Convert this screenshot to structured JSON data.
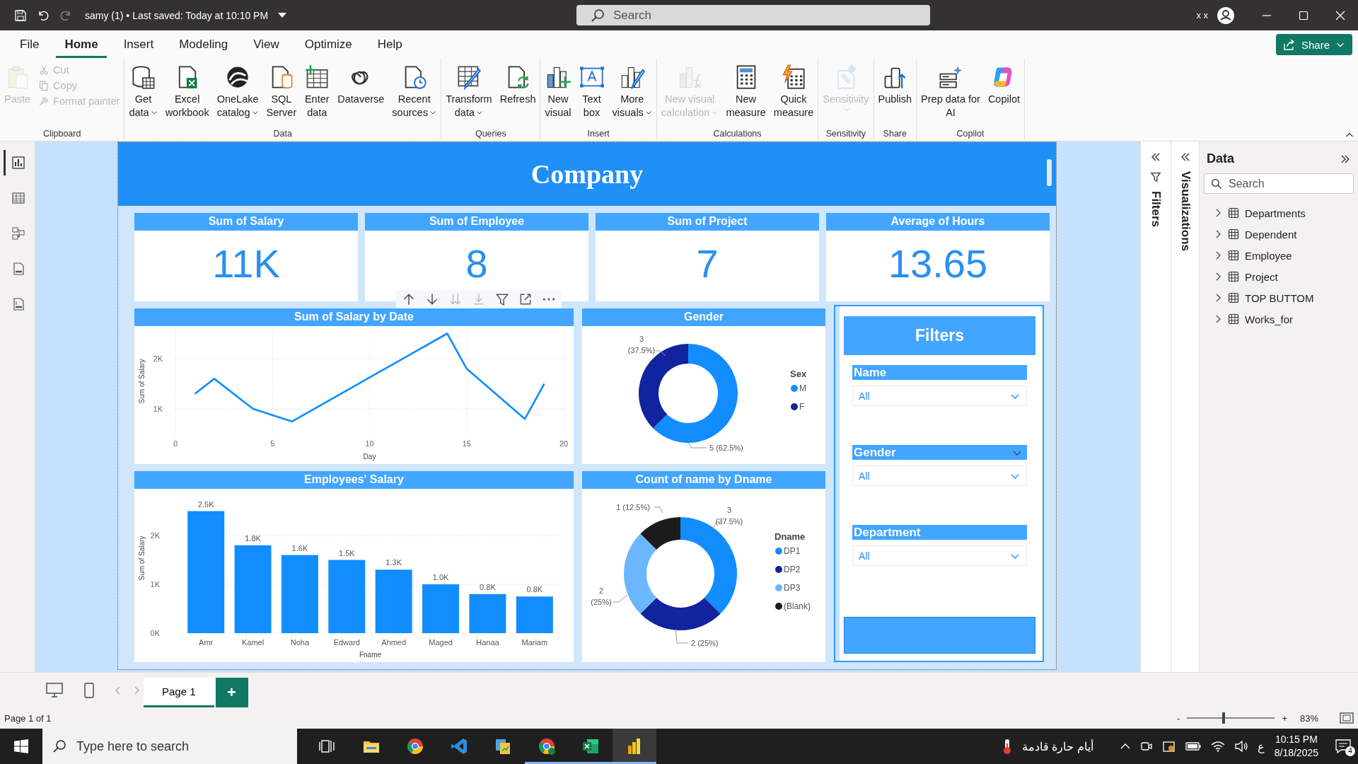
{
  "title_bar": {
    "document": "samy (1) • Last saved: Today at 10:10 PM",
    "search": {
      "placeholder": "Search"
    },
    "user": "x x"
  },
  "menu_tabs": [
    {
      "label": "File",
      "selected": false
    },
    {
      "label": "Home",
      "selected": true
    },
    {
      "label": "Insert",
      "selected": false
    },
    {
      "label": "Modeling",
      "selected": false
    },
    {
      "label": "View",
      "selected": false
    },
    {
      "label": "Optimize",
      "selected": false
    },
    {
      "label": "Help",
      "selected": false
    }
  ],
  "share_button": "Share",
  "ribbon": {
    "groups": [
      {
        "name": "Clipboard",
        "items": [
          {
            "kind": "large",
            "lines": [
              "Paste"
            ],
            "disabled": true,
            "dropdown": false
          },
          {
            "kind": "small",
            "lines": [
              "Cut"
            ],
            "disabled": true,
            "dropdown": false
          },
          {
            "kind": "small",
            "lines": [
              "Copy"
            ],
            "disabled": true,
            "dropdown": false
          },
          {
            "kind": "small",
            "lines": [
              "Format painter"
            ],
            "disabled": true,
            "dropdown": false
          }
        ]
      },
      {
        "name": "Data",
        "items": [
          {
            "kind": "large",
            "lines": [
              "Get",
              "data"
            ],
            "disabled": false,
            "dropdown": true
          },
          {
            "kind": "large",
            "lines": [
              "Excel",
              "workbook"
            ],
            "disabled": false,
            "dropdown": false
          },
          {
            "kind": "large",
            "lines": [
              "OneLake",
              "catalog"
            ],
            "disabled": false,
            "dropdown": true
          },
          {
            "kind": "large",
            "lines": [
              "SQL",
              "Server"
            ],
            "disabled": false,
            "dropdown": false
          },
          {
            "kind": "large",
            "lines": [
              "Enter",
              "data"
            ],
            "disabled": false,
            "dropdown": false
          },
          {
            "kind": "large",
            "lines": [
              "Dataverse"
            ],
            "disabled": false,
            "dropdown": false
          },
          {
            "kind": "large",
            "lines": [
              "Recent",
              "sources"
            ],
            "disabled": false,
            "dropdown": true
          }
        ]
      },
      {
        "name": "Queries",
        "items": [
          {
            "kind": "large",
            "lines": [
              "Transform",
              "data"
            ],
            "disabled": false,
            "dropdown": true
          },
          {
            "kind": "large",
            "lines": [
              "Refresh"
            ],
            "disabled": false,
            "dropdown": false
          }
        ]
      },
      {
        "name": "Insert",
        "items": [
          {
            "kind": "large",
            "lines": [
              "New",
              "visual"
            ],
            "disabled": false,
            "dropdown": false
          },
          {
            "kind": "large",
            "lines": [
              "Text",
              "box"
            ],
            "disabled": false,
            "dropdown": false
          },
          {
            "kind": "large",
            "lines": [
              "More",
              "visuals"
            ],
            "disabled": false,
            "dropdown": true
          }
        ]
      },
      {
        "name": "Calculations",
        "items": [
          {
            "kind": "large",
            "lines": [
              "New visual",
              "calculation"
            ],
            "disabled": true,
            "dropdown": true
          },
          {
            "kind": "large",
            "lines": [
              "New",
              "measure"
            ],
            "disabled": false,
            "dropdown": false
          },
          {
            "kind": "large",
            "lines": [
              "Quick",
              "measure"
            ],
            "disabled": false,
            "dropdown": false
          }
        ]
      },
      {
        "name": "Sensitivity",
        "items": [
          {
            "kind": "large",
            "lines": [
              "Sensitivity"
            ],
            "disabled": true,
            "dropdown": true
          }
        ]
      },
      {
        "name": "Share",
        "items": [
          {
            "kind": "large",
            "lines": [
              "Publish"
            ],
            "disabled": false,
            "dropdown": false
          }
        ]
      },
      {
        "name": "Copilot",
        "items": [
          {
            "kind": "large",
            "lines": [
              "Prep data for",
              "AI"
            ],
            "disabled": false,
            "dropdown": false
          },
          {
            "kind": "large",
            "lines": [
              "Copilot"
            ],
            "disabled": false,
            "dropdown": false
          }
        ]
      }
    ]
  },
  "view_switcher": [
    {
      "selected": true
    },
    {
      "selected": false
    },
    {
      "selected": false
    },
    {
      "selected": false
    },
    {
      "selected": false
    }
  ],
  "report": {
    "title": "Company",
    "cards": [
      {
        "label": "Sum of Salary",
        "value": "11K"
      },
      {
        "label": "Sum of Employee",
        "value": "8"
      },
      {
        "label": "Sum of Project",
        "value": "7"
      },
      {
        "label": "Average of Hours",
        "value": "13.65"
      }
    ],
    "charts": [
      {
        "chart_data": {
          "type": "line",
          "title": "Sum of Salary by Date",
          "grid": true,
          "xlabel": "Day",
          "ylabel": "Sum of Salary",
          "x": [
            1,
            2,
            4,
            6,
            14,
            15,
            18,
            19
          ],
          "values": [
            1300,
            1600,
            1000,
            750,
            2500,
            1800,
            800,
            1500
          ],
          "xlim": [
            0,
            20
          ],
          "ylim": [
            500,
            2600
          ],
          "xticks": [
            0,
            5,
            10,
            15,
            20
          ],
          "yticks": [
            {
              "value": 1000,
              "label": "1K"
            },
            {
              "value": 2000,
              "label": "2K"
            }
          ]
        }
      },
      {
        "chart_data": {
          "type": "donut",
          "title": "Gender",
          "categories": [
            "M",
            "F"
          ],
          "values": [
            5,
            3
          ],
          "colors": [
            "#118dff",
            "#12239e"
          ],
          "value_labels": [
            "5 (62.5%)",
            "3 (37.5%)"
          ],
          "legend": true
        },
        "legend_title": "Sex"
      },
      {
        "chart_data": {
          "type": "bar",
          "title": "Employees' Salary",
          "grid": true,
          "xlabel": "Fname",
          "ylabel": "Sum of Salary",
          "categories": [
            "Amr",
            "Kamel",
            "Noha",
            "Edward",
            "Ahmed",
            "Maged",
            "Hanaa",
            "Mariam"
          ],
          "values": [
            2500,
            1800,
            1600,
            1500,
            1300,
            1000,
            800,
            750
          ],
          "value_labels": [
            "2.5K",
            "1.8K",
            "1.6K",
            "1.5K",
            "1.3K",
            "1.0K",
            "0.8K",
            "0.8K"
          ],
          "ylim": [
            0,
            2500
          ],
          "yticks": [
            {
              "value": 0,
              "label": "0K"
            },
            {
              "value": 1000,
              "label": "1K"
            },
            {
              "value": 2000,
              "label": "2K"
            }
          ]
        }
      },
      {
        "chart_data": {
          "type": "donut",
          "title": "Count of name by Dname",
          "categories": [
            "DP1",
            "DP2",
            "DP3",
            "(Blank)"
          ],
          "values": [
            3,
            2,
            2,
            1
          ],
          "colors": [
            "#118dff",
            "#12239e",
            "#6cb6ff",
            "#1b1b1b"
          ],
          "value_labels": [
            "3 (37.5%)",
            "2 (25%)",
            "2 (25%)",
            "1 (12.5%)"
          ],
          "legend": true
        },
        "legend_title": "Dname"
      }
    ],
    "filters_panel": {
      "title": "Filters",
      "slicers": [
        {
          "title": "Name",
          "value": "All",
          "header_menu": false
        },
        {
          "title": "Gender",
          "value": "All",
          "header_menu": true
        },
        {
          "title": "Department",
          "value": "All",
          "header_menu": false
        }
      ]
    }
  },
  "filters_pane": {
    "label": "Filters"
  },
  "visualizations_pane": {
    "label": "Visualizations"
  },
  "data_pane": {
    "title": "Data",
    "search": {
      "placeholder": "Search"
    },
    "tables": [
      {
        "name": "Departments",
        "expanded": false
      },
      {
        "name": "Dependent",
        "expanded": false
      },
      {
        "name": "Employee",
        "expanded": false
      },
      {
        "name": "Project",
        "expanded": false
      },
      {
        "name": "TOP BUTTOM",
        "expanded": false
      },
      {
        "name": "Works_for",
        "expanded": false
      }
    ]
  },
  "pages": [
    {
      "label": "Page 1",
      "selected": true
    }
  ],
  "add_page": "+",
  "status_bar": {
    "page_info": "Page 1 of 1",
    "zoom_out": "-",
    "zoom_in": "+",
    "zoom": "83%",
    "zoom_slider": {
      "level": 0.42
    }
  },
  "taskbar": {
    "search": {
      "placeholder": "Type here to search"
    },
    "apps": [
      {
        "running": false,
        "selected": false
      },
      {
        "running": false,
        "selected": false
      },
      {
        "running": false,
        "selected": false
      },
      {
        "running": false,
        "selected": false
      },
      {
        "running": false,
        "selected": false
      },
      {
        "running": true,
        "selected": false
      },
      {
        "running": true,
        "selected": false
      },
      {
        "running": true,
        "selected": true
      }
    ],
    "weather": "أيام حارة قادمة",
    "input_language": "ع",
    "time": "10:15 PM",
    "date": "8/18/2025",
    "notifications": "4"
  }
}
